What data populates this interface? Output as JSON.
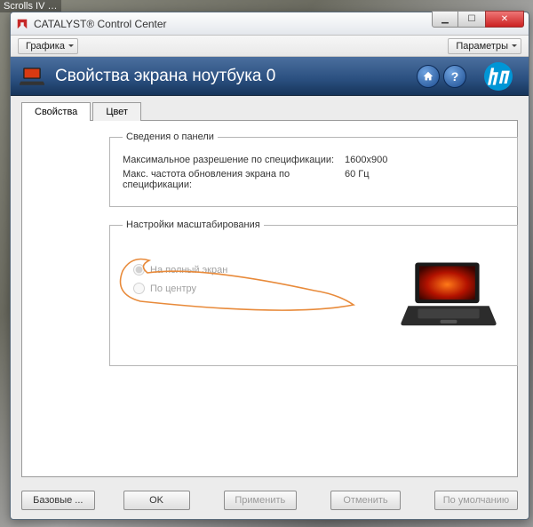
{
  "background_label": "Scrolls IV …",
  "window": {
    "title": "CATALYST® Control Center"
  },
  "toolbar": {
    "left_label": "Графика",
    "right_label": "Параметры"
  },
  "banner": {
    "title": "Свойства экрана ноутбука 0"
  },
  "tabs": [
    {
      "label": "Свойства",
      "active": true
    },
    {
      "label": "Цвет",
      "active": false
    }
  ],
  "panel_info": {
    "legend": "Сведения о панели",
    "rows": [
      {
        "label": "Максимальное разрешение по спецификации:",
        "value": "1600x900"
      },
      {
        "label": "Макс. частота обновления экрана по спецификации:",
        "value": "60 Гц"
      }
    ]
  },
  "scaling": {
    "legend": "Настройки масштабирования",
    "options": [
      {
        "label": "На полный экран",
        "selected": true,
        "disabled": true
      },
      {
        "label": "По центру",
        "selected": false,
        "disabled": true
      }
    ]
  },
  "footer": {
    "buttons": [
      {
        "label": "Базовые ...",
        "disabled": false
      },
      {
        "label": "OK",
        "disabled": false
      },
      {
        "label": "Применить",
        "disabled": true
      },
      {
        "label": "Отменить",
        "disabled": true
      },
      {
        "label": "По умолчанию",
        "disabled": true
      }
    ]
  },
  "icons": {
    "home": "home-icon",
    "help": "help-icon",
    "laptop": "laptop-icon",
    "amd": "amd-icon"
  }
}
